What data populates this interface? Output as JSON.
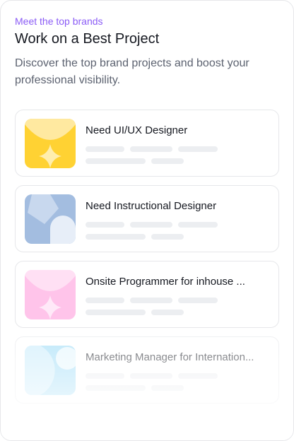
{
  "header": {
    "eyebrow": "Meet the top brands",
    "title": "Work on a Best Project",
    "description": "Discover the top brand projects and boost your professional visibility."
  },
  "projects": [
    {
      "title": "Need UI/UX Designer",
      "thumb_colors": [
        "#ffd233",
        "#ffe9a0",
        "#fff3c4"
      ]
    },
    {
      "title": "Need Instructional Designer",
      "thumb_colors": [
        "#a3bde0",
        "#c8d8ee",
        "#e7eef8"
      ]
    },
    {
      "title": "Onsite Programmer for inhouse ...",
      "thumb_colors": [
        "#ffc4ea",
        "#ffe0f4",
        "#fff0fa"
      ]
    },
    {
      "title": "Marketing Manager for Internation...",
      "thumb_colors": [
        "#9fdcf7",
        "#c9ecfb",
        "#e4f6fd"
      ]
    }
  ]
}
